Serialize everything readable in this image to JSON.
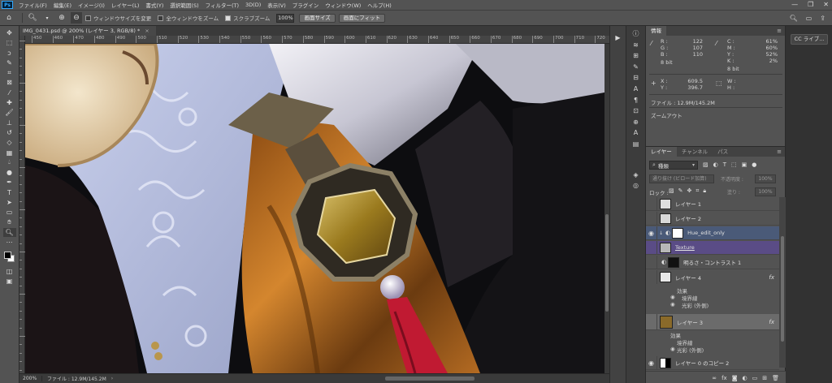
{
  "menu": {
    "logo": "Ps",
    "items": [
      "ファイル(F)",
      "編集(E)",
      "イメージ(I)",
      "レイヤー(L)",
      "書式(Y)",
      "選択範囲(S)",
      "フィルター(T)",
      "3D(D)",
      "表示(V)",
      "プラグイン",
      "ウィンドウ(W)",
      "ヘルプ(H)"
    ],
    "window_buttons": [
      "—",
      "❐",
      "✕"
    ]
  },
  "options": {
    "resize_windows_label": "ウィンドウサイズを変更",
    "resize_windows_checked": false,
    "zoom_all_label": "全ウィンドウをズーム",
    "zoom_all_checked": false,
    "scrubby_zoom_label": "スクラブズーム",
    "scrubby_zoom_checked": true,
    "zoom_value": "100%",
    "fit_screen_label": "画面サイズ",
    "fill_screen_label": "画面にフィット"
  },
  "document": {
    "tab_title": "IMG_0431.psd @ 200% (レイヤー 3, RGB/8) *",
    "close": "×"
  },
  "ruler": {
    "h_ticks": [
      "450",
      "460",
      "470",
      "480",
      "490",
      "500",
      "510",
      "520",
      "530",
      "540",
      "550",
      "560",
      "570",
      "580",
      "590",
      "600",
      "610",
      "620",
      "630",
      "640",
      "650",
      "660",
      "670",
      "680",
      "690",
      "700",
      "710",
      "720"
    ]
  },
  "status": {
    "zoom": "200%",
    "file_info": "ファイル : 12.9M/145.2M",
    "arrow": "›"
  },
  "info_panel": {
    "tab": "情報",
    "menu": "≡",
    "rgb": {
      "r_label": "R :",
      "g_label": "G :",
      "b_label": "B :",
      "r": "122",
      "g": "107",
      "b": "110"
    },
    "cmyk": {
      "c_label": "C :",
      "m_label": "M :",
      "y_label": "Y :",
      "k_label": "K :",
      "c": "61%",
      "m": "60%",
      "y": "52%",
      "k": "2%"
    },
    "bits_left": "8 bit",
    "bits_right": "8 bit",
    "xy": {
      "x_label": "X :",
      "y_label": "Y :",
      "x": "609.5",
      "y": "396.7"
    },
    "wh": {
      "w_label": "W :",
      "h_label": "H :"
    },
    "file_line": "ファイル : 12.9M/145.2M",
    "zoom_out": "ズームアウト"
  },
  "cc_panel": {
    "label": "CC ライブ..."
  },
  "layers_panel": {
    "tabs": [
      "レイヤー",
      "チャンネル",
      "パス"
    ],
    "kind_label": "種類",
    "blend_mode": "通り抜け (ビロード加算)",
    "opacity_label": "不透明度 :",
    "opacity": "100%",
    "lock_label": "ロック :",
    "fill_label": "塗り :",
    "fill": "100%",
    "layers": [
      {
        "name": "レイヤー 1",
        "visible": false,
        "fx": ""
      },
      {
        "name": "レイヤー 2",
        "visible": false,
        "fx": ""
      },
      {
        "name": "Hue_edit_only",
        "visible": true,
        "fx": ""
      },
      {
        "name": "Texture",
        "visible": false,
        "fx": ""
      },
      {
        "name": "明るさ・コントラスト 1",
        "visible": false,
        "fx": ""
      },
      {
        "name": "レイヤー 4",
        "visible": false,
        "fx": "fx"
      },
      {
        "name": "レイヤー 3",
        "visible": false,
        "fx": "fx"
      },
      {
        "name": "レイヤー 0 のコピー 2",
        "visible": true,
        "fx": ""
      }
    ],
    "effects_label": "効果",
    "stroke_label": "境界線",
    "outer_glow_label": "光彩 (外側)",
    "effects_label2": "効果",
    "stroke_label2": "境界線",
    "outer_glow_label2": "光彩 (外側)"
  },
  "colors": {
    "chrome_dark": "#323232",
    "chrome_mid": "#535353",
    "accent_blue": "#31a8ff",
    "selected_layer": "#6b6b6b"
  }
}
